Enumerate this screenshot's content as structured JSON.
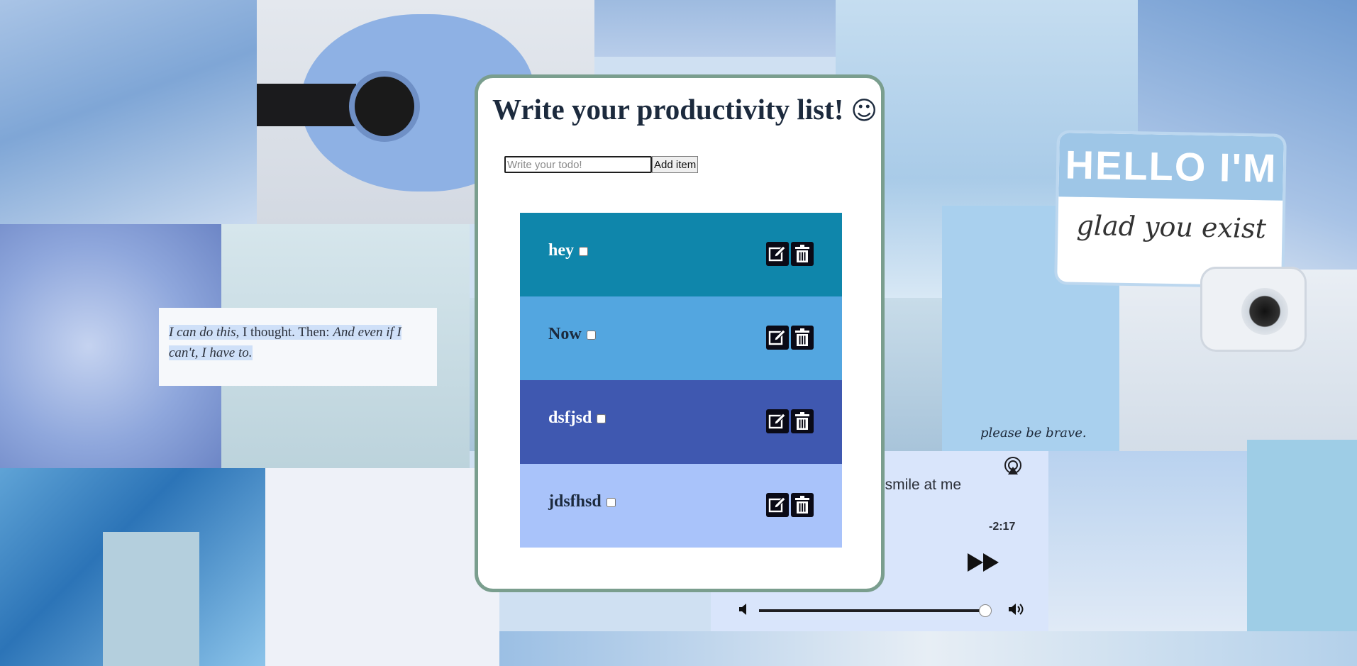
{
  "background": {
    "quote_part1": "I can do this,",
    "quote_part2": " I thought. Then: ",
    "quote_part3": "And even if I can't, I have to.",
    "hello_card_title": "HELLO I'M",
    "hello_card_script": "glad you exist",
    "brave_text": "please be brave.",
    "music_line": "t smile at me",
    "music_time": "-2:17"
  },
  "app": {
    "title": "Write your productivity list!",
    "title_emoji": "☺",
    "input_placeholder": "Write your todo!",
    "input_value": "",
    "add_button_label": "Add item",
    "items": [
      {
        "text": "hey",
        "checked": false,
        "bg": "#0f86ab",
        "color": "#ffffff"
      },
      {
        "text": "Now",
        "checked": false,
        "bg": "#53a6e0",
        "color": "#1c2a3d"
      },
      {
        "text": "dsfjsd",
        "checked": false,
        "bg": "#3f58b0",
        "color": "#ffffff"
      },
      {
        "text": "jdsfhsd",
        "checked": false,
        "bg": "#a9c3fa",
        "color": "#1c2a3d"
      }
    ],
    "edit_icon": "edit-icon",
    "delete_icon": "trash-icon",
    "colors": {
      "card_border": "#7a9e8e",
      "title": "#1c2a3d",
      "icon_bg": "#0a0a16"
    }
  }
}
